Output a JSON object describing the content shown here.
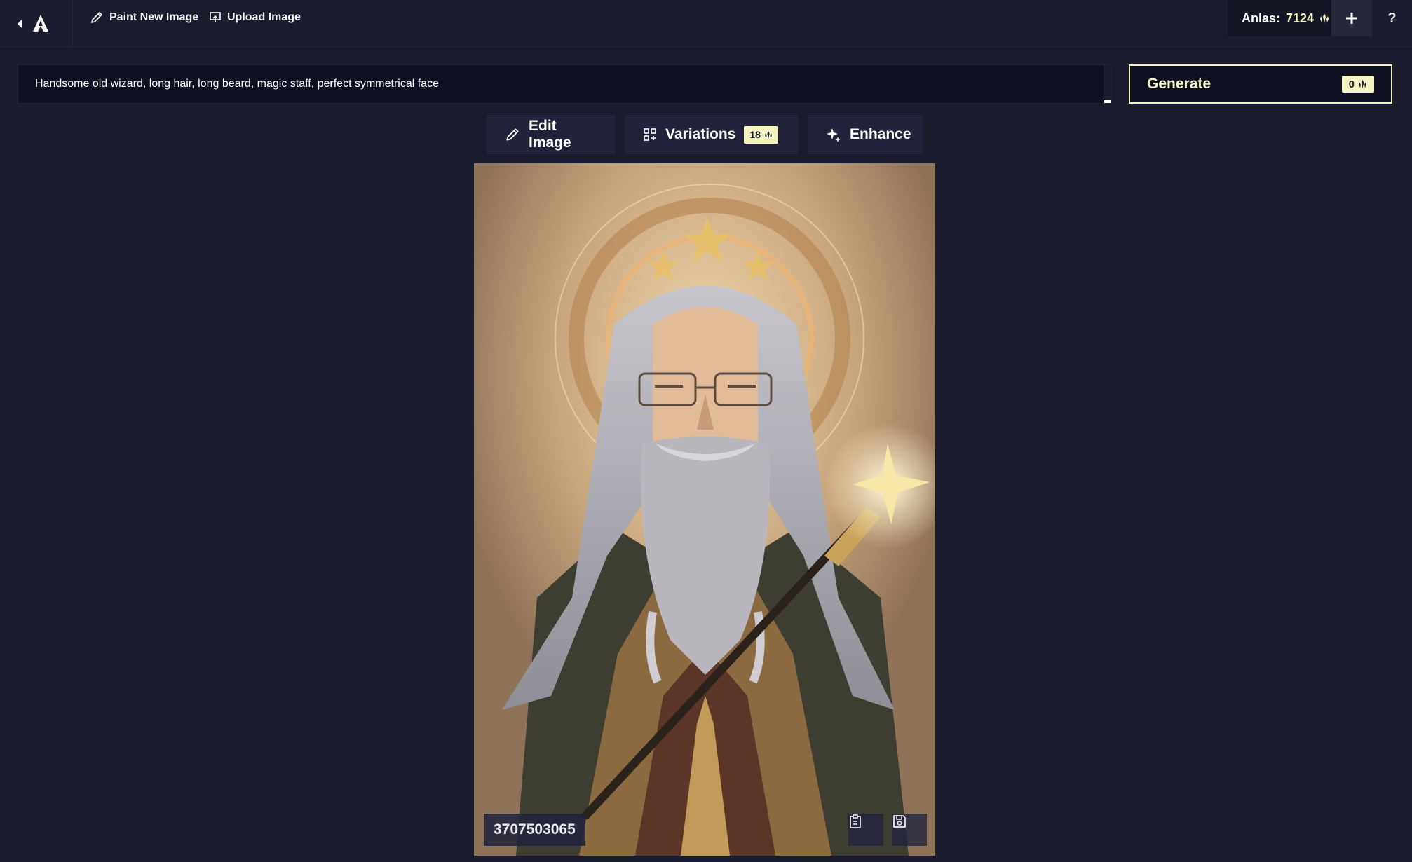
{
  "app": {
    "toolbar": {
      "paint_new_label": "Paint New Image",
      "upload_label": "Upload Image"
    },
    "anlas": {
      "label": "Anlas:",
      "amount": "7124"
    },
    "help_label": "?"
  },
  "prompt": {
    "value": "Handsome old wizard, long hair, long beard, magic staff, perfect symmetrical face"
  },
  "generate": {
    "label": "Generate",
    "cost": "0"
  },
  "actions": {
    "edit_label": "Edit Image",
    "variations_label": "Variations",
    "variations_cost": "18",
    "enhance_label": "Enhance"
  },
  "image": {
    "seed": "3707503065"
  },
  "colors": {
    "background": "#1b1c2e",
    "accent": "#f5f3c2",
    "panel": "#22233a",
    "input": "#0e0f21"
  },
  "icons": [
    "back-arrow-icon",
    "logo-icon",
    "brush-icon",
    "upload-icon",
    "anlas-icon",
    "plus-icon",
    "variations-icon",
    "sparkle-icon",
    "clipboard-icon",
    "save-icon"
  ]
}
